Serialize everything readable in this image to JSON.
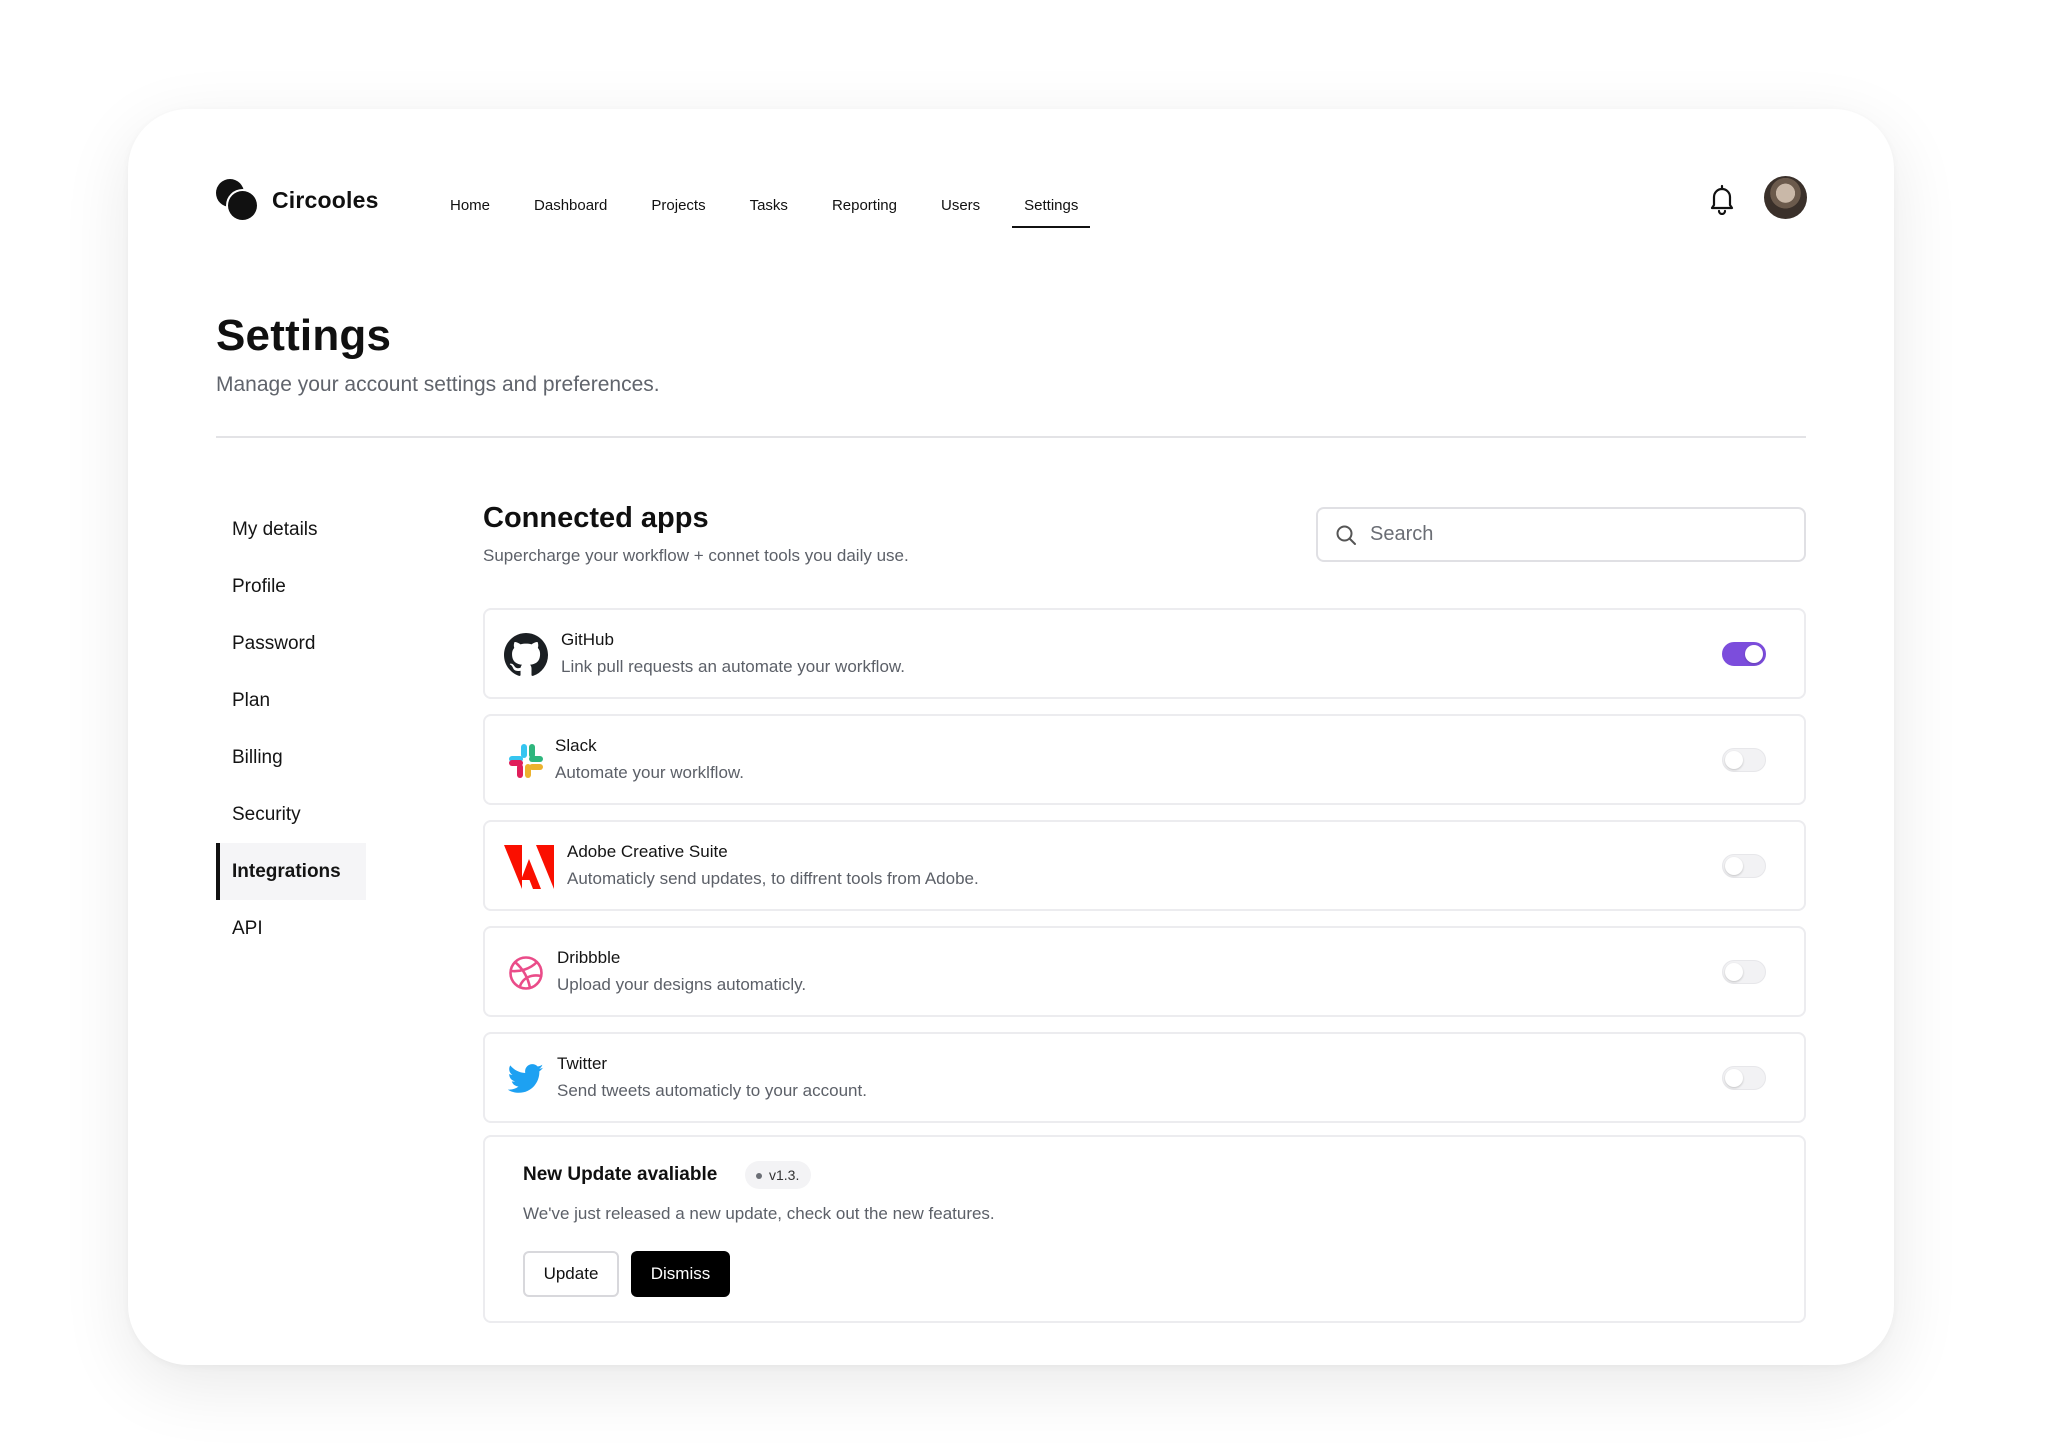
{
  "brand": {
    "name": "Circooles"
  },
  "nav": {
    "items": [
      {
        "label": "Home"
      },
      {
        "label": "Dashboard"
      },
      {
        "label": "Projects"
      },
      {
        "label": "Tasks"
      },
      {
        "label": "Reporting"
      },
      {
        "label": "Users"
      },
      {
        "label": "Settings",
        "active": true
      }
    ]
  },
  "page": {
    "title": "Settings",
    "subtitle": "Manage your account settings and preferences."
  },
  "sidebar": {
    "items": [
      {
        "label": "My details"
      },
      {
        "label": "Profile"
      },
      {
        "label": "Password"
      },
      {
        "label": "Plan"
      },
      {
        "label": "Billing"
      },
      {
        "label": "Security"
      },
      {
        "label": "Integrations",
        "active": true
      },
      {
        "label": "API"
      }
    ]
  },
  "connected": {
    "title": "Connected apps",
    "subtitle": "Supercharge your workflow + connet tools you daily use.",
    "search_placeholder": "Search",
    "apps": [
      {
        "name": "GitHub",
        "description": "Link pull requests an automate your workflow.",
        "icon": "github-icon",
        "enabled": true
      },
      {
        "name": "Slack",
        "description": "Automate your worklflow.",
        "icon": "slack-icon",
        "enabled": false
      },
      {
        "name": "Adobe Creative Suite",
        "description": "Automaticly send updates, to diffrent tools from Adobe.",
        "icon": "adobe-icon",
        "enabled": false
      },
      {
        "name": "Dribbble",
        "description": "Upload your designs automaticly.",
        "icon": "dribbble-icon",
        "enabled": false
      },
      {
        "name": "Twitter",
        "description": "Send tweets automaticly to your account.",
        "icon": "twitter-icon",
        "enabled": false
      }
    ]
  },
  "update": {
    "title": "New Update avaliable",
    "version": "v1.3.",
    "description": "We've just released a new update, check out the new features.",
    "update_label": "Update",
    "dismiss_label": "Dismiss"
  },
  "colors": {
    "accent": "#7c4ddc",
    "dribbble": "#ea4c89",
    "twitter": "#1da1f2",
    "adobe": "#fa0f00"
  }
}
